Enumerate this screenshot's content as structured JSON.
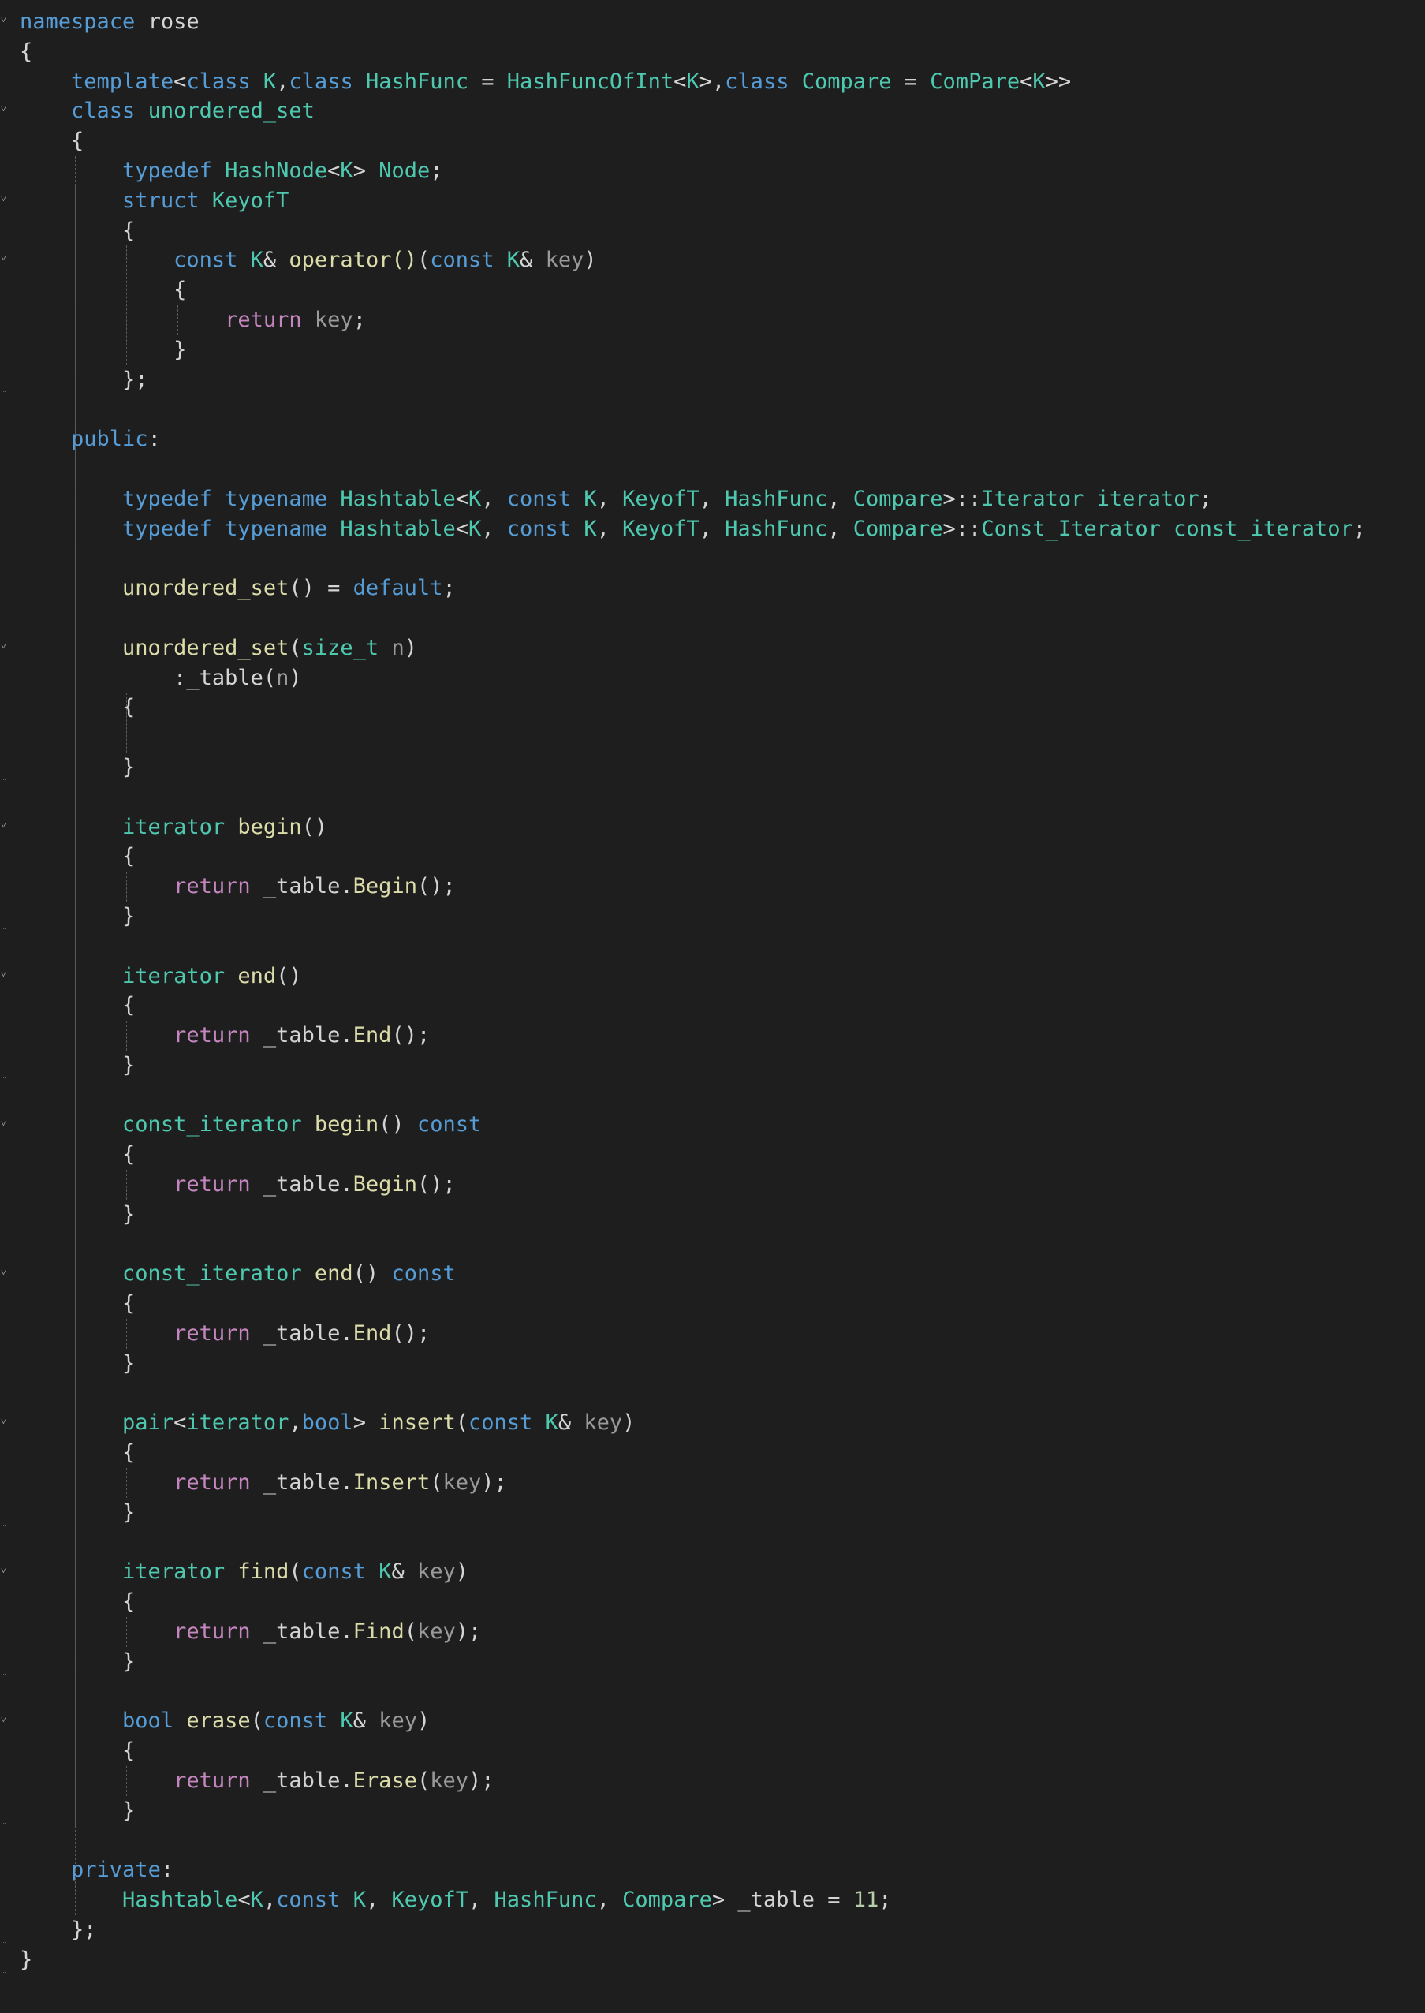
{
  "colors": {
    "background": "#1e1e1e",
    "plain": "#d4d4d4",
    "keyword": "#569cd6",
    "control": "#c586c0",
    "type": "#4ec9b0",
    "function": "#dcdcaa",
    "parameter": "#9cdcfe",
    "parameter_dim": "#9a9a9a",
    "number": "#b5cea8",
    "guide": "#5a5a5a"
  },
  "lines": [
    {
      "segs": [
        [
          "namespace",
          "keyword"
        ],
        [
          " rose",
          "plain"
        ]
      ]
    },
    {
      "segs": [
        [
          "{",
          "plain"
        ]
      ]
    },
    {
      "segs": [
        [
          "    ",
          "plain"
        ],
        [
          "template",
          "keyword"
        ],
        [
          "<",
          "plain"
        ],
        [
          "class",
          "keyword"
        ],
        [
          " ",
          "plain"
        ],
        [
          "K",
          "type"
        ],
        [
          ",",
          "plain"
        ],
        [
          "class",
          "keyword"
        ],
        [
          " ",
          "plain"
        ],
        [
          "HashFunc",
          "type"
        ],
        [
          " = ",
          "plain"
        ],
        [
          "HashFuncOfInt",
          "type"
        ],
        [
          "<",
          "plain"
        ],
        [
          "K",
          "type"
        ],
        [
          ">,",
          "plain"
        ],
        [
          "class",
          "keyword"
        ],
        [
          " ",
          "plain"
        ],
        [
          "Compare",
          "type"
        ],
        [
          " = ",
          "plain"
        ],
        [
          "ComPare",
          "type"
        ],
        [
          "<",
          "plain"
        ],
        [
          "K",
          "type"
        ],
        [
          ">>",
          "plain"
        ]
      ]
    },
    {
      "segs": [
        [
          "    ",
          "plain"
        ],
        [
          "class",
          "keyword"
        ],
        [
          " ",
          "plain"
        ],
        [
          "unordered_set",
          "type"
        ]
      ]
    },
    {
      "segs": [
        [
          "    {",
          "plain"
        ]
      ]
    },
    {
      "segs": [
        [
          "        ",
          "plain"
        ],
        [
          "typedef",
          "keyword"
        ],
        [
          " ",
          "plain"
        ],
        [
          "HashNode",
          "type"
        ],
        [
          "<",
          "plain"
        ],
        [
          "K",
          "type"
        ],
        [
          "> ",
          "plain"
        ],
        [
          "Node",
          "type"
        ],
        [
          ";",
          "plain"
        ]
      ]
    },
    {
      "segs": [
        [
          "        ",
          "plain"
        ],
        [
          "struct",
          "keyword"
        ],
        [
          " ",
          "plain"
        ],
        [
          "KeyofT",
          "type"
        ]
      ]
    },
    {
      "segs": [
        [
          "        {",
          "plain"
        ]
      ]
    },
    {
      "segs": [
        [
          "            ",
          "plain"
        ],
        [
          "const",
          "keyword"
        ],
        [
          " ",
          "plain"
        ],
        [
          "K",
          "type"
        ],
        [
          "& ",
          "plain"
        ],
        [
          "operator()",
          "function"
        ],
        [
          "(",
          "plain"
        ],
        [
          "const",
          "keyword"
        ],
        [
          " ",
          "plain"
        ],
        [
          "K",
          "type"
        ],
        [
          "& ",
          "plain"
        ],
        [
          "key",
          "parameter_dim"
        ],
        [
          ")",
          "plain"
        ]
      ]
    },
    {
      "segs": [
        [
          "            {",
          "plain"
        ]
      ]
    },
    {
      "segs": [
        [
          "                ",
          "plain"
        ],
        [
          "return",
          "control"
        ],
        [
          " ",
          "plain"
        ],
        [
          "key",
          "parameter_dim"
        ],
        [
          ";",
          "plain"
        ]
      ]
    },
    {
      "segs": [
        [
          "            }",
          "plain"
        ]
      ]
    },
    {
      "segs": [
        [
          "        };",
          "plain"
        ]
      ]
    },
    {
      "segs": [
        [
          "",
          "plain"
        ]
      ]
    },
    {
      "segs": [
        [
          "    ",
          "plain"
        ],
        [
          "public",
          "keyword"
        ],
        [
          ":",
          "plain"
        ]
      ]
    },
    {
      "segs": [
        [
          "",
          "plain"
        ]
      ]
    },
    {
      "segs": [
        [
          "        ",
          "plain"
        ],
        [
          "typedef",
          "keyword"
        ],
        [
          " ",
          "plain"
        ],
        [
          "typename",
          "keyword"
        ],
        [
          " ",
          "plain"
        ],
        [
          "Hashtable",
          "type"
        ],
        [
          "<",
          "plain"
        ],
        [
          "K",
          "type"
        ],
        [
          ", ",
          "plain"
        ],
        [
          "const",
          "keyword"
        ],
        [
          " ",
          "plain"
        ],
        [
          "K",
          "type"
        ],
        [
          ", ",
          "plain"
        ],
        [
          "KeyofT",
          "type"
        ],
        [
          ", ",
          "plain"
        ],
        [
          "HashFunc",
          "type"
        ],
        [
          ", ",
          "plain"
        ],
        [
          "Compare",
          "type"
        ],
        [
          ">::",
          "plain"
        ],
        [
          "Iterator",
          "type"
        ],
        [
          " ",
          "plain"
        ],
        [
          "iterator",
          "type"
        ],
        [
          ";",
          "plain"
        ]
      ]
    },
    {
      "segs": [
        [
          "        ",
          "plain"
        ],
        [
          "typedef",
          "keyword"
        ],
        [
          " ",
          "plain"
        ],
        [
          "typename",
          "keyword"
        ],
        [
          " ",
          "plain"
        ],
        [
          "Hashtable",
          "type"
        ],
        [
          "<",
          "plain"
        ],
        [
          "K",
          "type"
        ],
        [
          ", ",
          "plain"
        ],
        [
          "const",
          "keyword"
        ],
        [
          " ",
          "plain"
        ],
        [
          "K",
          "type"
        ],
        [
          ", ",
          "plain"
        ],
        [
          "KeyofT",
          "type"
        ],
        [
          ", ",
          "plain"
        ],
        [
          "HashFunc",
          "type"
        ],
        [
          ", ",
          "plain"
        ],
        [
          "Compare",
          "type"
        ],
        [
          ">::",
          "plain"
        ],
        [
          "Const_Iterator",
          "type"
        ],
        [
          " ",
          "plain"
        ],
        [
          "const_iterator",
          "type"
        ],
        [
          ";",
          "plain"
        ]
      ]
    },
    {
      "segs": [
        [
          "",
          "plain"
        ]
      ]
    },
    {
      "segs": [
        [
          "        ",
          "plain"
        ],
        [
          "unordered_set",
          "function"
        ],
        [
          "() = ",
          "plain"
        ],
        [
          "default",
          "keyword"
        ],
        [
          ";",
          "plain"
        ]
      ]
    },
    {
      "segs": [
        [
          "",
          "plain"
        ]
      ]
    },
    {
      "segs": [
        [
          "        ",
          "plain"
        ],
        [
          "unordered_set",
          "function"
        ],
        [
          "(",
          "plain"
        ],
        [
          "size_t",
          "type"
        ],
        [
          " ",
          "plain"
        ],
        [
          "n",
          "parameter_dim"
        ],
        [
          ")",
          "plain"
        ]
      ]
    },
    {
      "segs": [
        [
          "            :_table(",
          "plain"
        ],
        [
          "n",
          "parameter_dim"
        ],
        [
          ")",
          "plain"
        ]
      ]
    },
    {
      "segs": [
        [
          "        {",
          "plain"
        ]
      ]
    },
    {
      "segs": [
        [
          "",
          "plain"
        ]
      ]
    },
    {
      "segs": [
        [
          "        }",
          "plain"
        ]
      ]
    },
    {
      "segs": [
        [
          "",
          "plain"
        ]
      ]
    },
    {
      "segs": [
        [
          "        ",
          "plain"
        ],
        [
          "iterator",
          "type"
        ],
        [
          " ",
          "plain"
        ],
        [
          "begin",
          "function"
        ],
        [
          "()",
          "plain"
        ]
      ]
    },
    {
      "segs": [
        [
          "        {",
          "plain"
        ]
      ]
    },
    {
      "segs": [
        [
          "            ",
          "plain"
        ],
        [
          "return",
          "control"
        ],
        [
          " _table.",
          "plain"
        ],
        [
          "Begin",
          "function"
        ],
        [
          "();",
          "plain"
        ]
      ]
    },
    {
      "segs": [
        [
          "        }",
          "plain"
        ]
      ]
    },
    {
      "segs": [
        [
          "",
          "plain"
        ]
      ]
    },
    {
      "segs": [
        [
          "        ",
          "plain"
        ],
        [
          "iterator",
          "type"
        ],
        [
          " ",
          "plain"
        ],
        [
          "end",
          "function"
        ],
        [
          "()",
          "plain"
        ]
      ]
    },
    {
      "segs": [
        [
          "        {",
          "plain"
        ]
      ]
    },
    {
      "segs": [
        [
          "            ",
          "plain"
        ],
        [
          "return",
          "control"
        ],
        [
          " _table.",
          "plain"
        ],
        [
          "End",
          "function"
        ],
        [
          "();",
          "plain"
        ]
      ]
    },
    {
      "segs": [
        [
          "        }",
          "plain"
        ]
      ]
    },
    {
      "segs": [
        [
          "",
          "plain"
        ]
      ]
    },
    {
      "segs": [
        [
          "        ",
          "plain"
        ],
        [
          "const_iterator",
          "type"
        ],
        [
          " ",
          "plain"
        ],
        [
          "begin",
          "function"
        ],
        [
          "() ",
          "plain"
        ],
        [
          "const",
          "keyword"
        ]
      ]
    },
    {
      "segs": [
        [
          "        {",
          "plain"
        ]
      ]
    },
    {
      "segs": [
        [
          "            ",
          "plain"
        ],
        [
          "return",
          "control"
        ],
        [
          " _table.",
          "plain"
        ],
        [
          "Begin",
          "function"
        ],
        [
          "();",
          "plain"
        ]
      ]
    },
    {
      "segs": [
        [
          "        }",
          "plain"
        ]
      ]
    },
    {
      "segs": [
        [
          "",
          "plain"
        ]
      ]
    },
    {
      "segs": [
        [
          "        ",
          "plain"
        ],
        [
          "const_iterator",
          "type"
        ],
        [
          " ",
          "plain"
        ],
        [
          "end",
          "function"
        ],
        [
          "() ",
          "plain"
        ],
        [
          "const",
          "keyword"
        ]
      ]
    },
    {
      "segs": [
        [
          "        {",
          "plain"
        ]
      ]
    },
    {
      "segs": [
        [
          "            ",
          "plain"
        ],
        [
          "return",
          "control"
        ],
        [
          " _table.",
          "plain"
        ],
        [
          "End",
          "function"
        ],
        [
          "();",
          "plain"
        ]
      ]
    },
    {
      "segs": [
        [
          "        }",
          "plain"
        ]
      ]
    },
    {
      "segs": [
        [
          "",
          "plain"
        ]
      ]
    },
    {
      "segs": [
        [
          "        ",
          "plain"
        ],
        [
          "pair",
          "type"
        ],
        [
          "<",
          "plain"
        ],
        [
          "iterator",
          "type"
        ],
        [
          ",",
          "plain"
        ],
        [
          "bool",
          "keyword"
        ],
        [
          "> ",
          "plain"
        ],
        [
          "insert",
          "function"
        ],
        [
          "(",
          "plain"
        ],
        [
          "const",
          "keyword"
        ],
        [
          " ",
          "plain"
        ],
        [
          "K",
          "type"
        ],
        [
          "& ",
          "plain"
        ],
        [
          "key",
          "parameter_dim"
        ],
        [
          ")",
          "plain"
        ]
      ]
    },
    {
      "segs": [
        [
          "        {",
          "plain"
        ]
      ]
    },
    {
      "segs": [
        [
          "            ",
          "plain"
        ],
        [
          "return",
          "control"
        ],
        [
          " _table.",
          "plain"
        ],
        [
          "Insert",
          "function"
        ],
        [
          "(",
          "plain"
        ],
        [
          "key",
          "parameter_dim"
        ],
        [
          ");",
          "plain"
        ]
      ]
    },
    {
      "segs": [
        [
          "        }",
          "plain"
        ]
      ]
    },
    {
      "segs": [
        [
          "",
          "plain"
        ]
      ]
    },
    {
      "segs": [
        [
          "        ",
          "plain"
        ],
        [
          "iterator",
          "type"
        ],
        [
          " ",
          "plain"
        ],
        [
          "find",
          "function"
        ],
        [
          "(",
          "plain"
        ],
        [
          "const",
          "keyword"
        ],
        [
          " ",
          "plain"
        ],
        [
          "K",
          "type"
        ],
        [
          "& ",
          "plain"
        ],
        [
          "key",
          "parameter_dim"
        ],
        [
          ")",
          "plain"
        ]
      ]
    },
    {
      "segs": [
        [
          "        {",
          "plain"
        ]
      ]
    },
    {
      "segs": [
        [
          "            ",
          "plain"
        ],
        [
          "return",
          "control"
        ],
        [
          " _table.",
          "plain"
        ],
        [
          "Find",
          "function"
        ],
        [
          "(",
          "plain"
        ],
        [
          "key",
          "parameter_dim"
        ],
        [
          ");",
          "plain"
        ]
      ]
    },
    {
      "segs": [
        [
          "        }",
          "plain"
        ]
      ]
    },
    {
      "segs": [
        [
          "",
          "plain"
        ]
      ]
    },
    {
      "segs": [
        [
          "        ",
          "plain"
        ],
        [
          "bool",
          "keyword"
        ],
        [
          " ",
          "plain"
        ],
        [
          "erase",
          "function"
        ],
        [
          "(",
          "plain"
        ],
        [
          "const",
          "keyword"
        ],
        [
          " ",
          "plain"
        ],
        [
          "K",
          "type"
        ],
        [
          "& ",
          "plain"
        ],
        [
          "key",
          "parameter_dim"
        ],
        [
          ")",
          "plain"
        ]
      ]
    },
    {
      "segs": [
        [
          "        {",
          "plain"
        ]
      ]
    },
    {
      "segs": [
        [
          "            ",
          "plain"
        ],
        [
          "return",
          "control"
        ],
        [
          " _table.",
          "plain"
        ],
        [
          "Erase",
          "function"
        ],
        [
          "(",
          "plain"
        ],
        [
          "key",
          "parameter_dim"
        ],
        [
          ");",
          "plain"
        ]
      ]
    },
    {
      "segs": [
        [
          "        }",
          "plain"
        ]
      ]
    },
    {
      "segs": [
        [
          "",
          "plain"
        ]
      ]
    },
    {
      "segs": [
        [
          "    ",
          "plain"
        ],
        [
          "private",
          "keyword"
        ],
        [
          ":",
          "plain"
        ]
      ]
    },
    {
      "segs": [
        [
          "        ",
          "plain"
        ],
        [
          "Hashtable",
          "type"
        ],
        [
          "<",
          "plain"
        ],
        [
          "K",
          "type"
        ],
        [
          ",",
          "plain"
        ],
        [
          "const",
          "keyword"
        ],
        [
          " ",
          "plain"
        ],
        [
          "K",
          "type"
        ],
        [
          ", ",
          "plain"
        ],
        [
          "KeyofT",
          "type"
        ],
        [
          ", ",
          "plain"
        ],
        [
          "HashFunc",
          "type"
        ],
        [
          ", ",
          "plain"
        ],
        [
          "Compare",
          "type"
        ],
        [
          "> _table = ",
          "plain"
        ],
        [
          "11",
          "number"
        ],
        [
          ";",
          "plain"
        ]
      ]
    },
    {
      "segs": [
        [
          "    };",
          "plain"
        ]
      ]
    },
    {
      "segs": [
        [
          "}",
          "plain"
        ]
      ]
    }
  ],
  "fold_icons": [
    "chevron-down-icon"
  ]
}
